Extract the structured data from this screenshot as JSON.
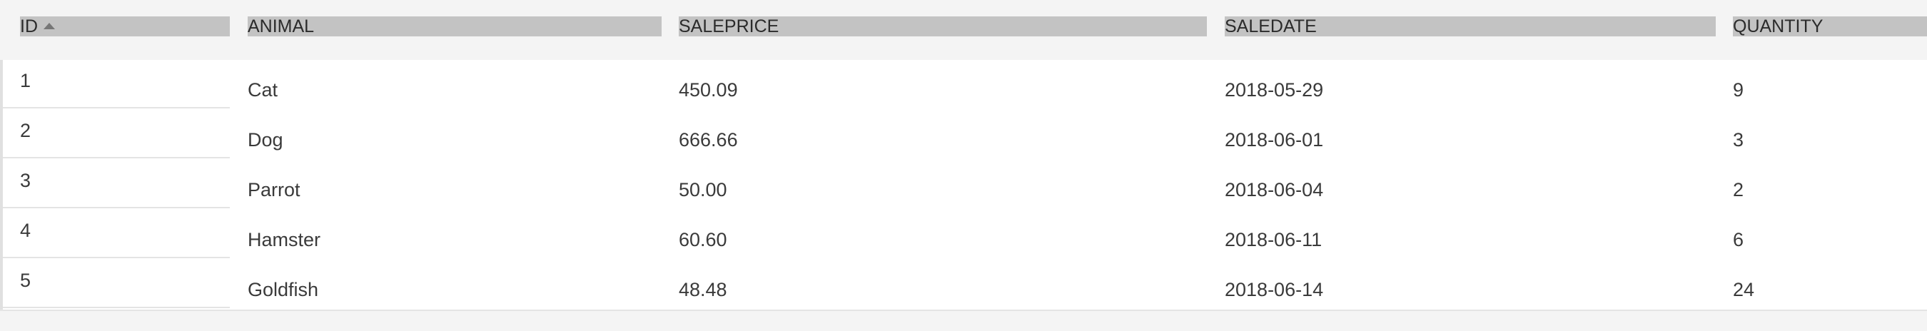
{
  "table": {
    "columns": [
      {
        "label": "ID",
        "sorted": "ascending"
      },
      {
        "label": "ANIMAL"
      },
      {
        "label": "SALEPRICE"
      },
      {
        "label": "SALEDATE"
      },
      {
        "label": "QUANTITY"
      }
    ],
    "rows": [
      {
        "id": "1",
        "animal": "Cat",
        "saleprice": "450.09",
        "saledate": "2018-05-29",
        "quantity": "9"
      },
      {
        "id": "2",
        "animal": "Dog",
        "saleprice": "666.66",
        "saledate": "2018-06-01",
        "quantity": "3"
      },
      {
        "id": "3",
        "animal": "Parrot",
        "saleprice": "50.00",
        "saledate": "2018-06-04",
        "quantity": "2"
      },
      {
        "id": "4",
        "animal": "Hamster",
        "saleprice": "60.60",
        "saledate": "2018-06-11",
        "quantity": "6"
      },
      {
        "id": "5",
        "animal": "Goldfish",
        "saleprice": "48.48",
        "saledate": "2018-06-14",
        "quantity": "24"
      }
    ]
  },
  "colors": {
    "header_background": "#f4f4f4",
    "header_label_background": "#c3c3c3",
    "row_border": "#e4e4e4",
    "text": "#3a3a3a"
  }
}
